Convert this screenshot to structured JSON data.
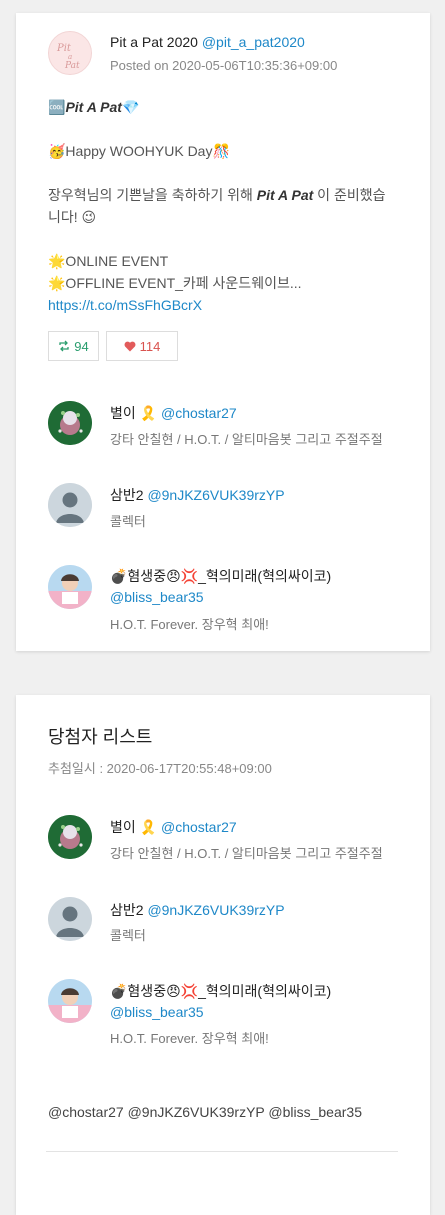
{
  "tweet": {
    "author_name": "Pit a Pat 2020",
    "author_handle": "@pit_a_pat2020",
    "posted_on": "Posted on 2020-05-06T10:35:36+09:00",
    "line1_badge": "🆒",
    "line1_bold": "Pit A Pat",
    "line1_tail": "💎",
    "line2": "🥳Happy WOOHYUK Day🎊",
    "line3a": "장우혁님의 기쁜날을 축하하기 위해 ",
    "line3_bold": "Pit A Pat",
    "line3b": " 이 준비했습",
    "line4": "니다! 😉",
    "line5": "🌟ONLINE EVENT",
    "line6": "🌟OFFLINE EVENT_카페 사운드웨이브...",
    "link": "https://t.co/mSsFhGBcrX",
    "retweets": "94",
    "likes": "114"
  },
  "participants": [
    {
      "name": "별이 🎗️",
      "handle": "@chostar27",
      "bio": "강타 안칠현 / H.O.T. / 알티마음봇 그리고 주절주절"
    },
    {
      "name": "삼반2",
      "handle": "@9nJKZ6VUK39rzYP",
      "bio": "콜렉터"
    },
    {
      "name": "💣혐생중😠💢_혁의미래(혁의싸이코)",
      "handle": "@bliss_bear35",
      "bio": "H.O.T. Forever. 장우혁 최애!"
    }
  ],
  "winners_section": {
    "title": "당첨자 리스트",
    "drawn_at": "추첨일시 : 2020-06-17T20:55:48+09:00",
    "summary": "@chostar27 @9nJKZ6VUK39rzYP @bliss_bear35"
  },
  "colors": {
    "link": "#1e88c8",
    "retweet": "#2a9d6e",
    "like": "#d9534f"
  }
}
